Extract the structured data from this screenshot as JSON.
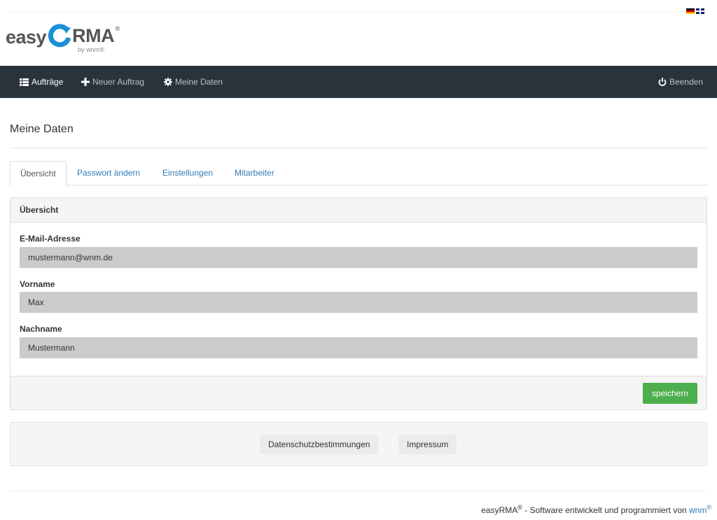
{
  "languages": [
    "Deutsch",
    "English"
  ],
  "logo": {
    "easy": "easy",
    "rma": "RMA",
    "reg": "®",
    "by": "by wnm®"
  },
  "nav": {
    "orders": "Aufträge",
    "new_order": "Neuer Auftrag",
    "my_data": "Meine Daten",
    "logout": "Beenden"
  },
  "page": {
    "title": "Meine Daten"
  },
  "tabs": [
    {
      "label": "Übersicht",
      "active": true
    },
    {
      "label": "Passwort ändern",
      "active": false
    },
    {
      "label": "Einstellungen",
      "active": false
    },
    {
      "label": "Mitarbeiter",
      "active": false
    }
  ],
  "panel": {
    "heading": "Übersicht",
    "fields": [
      {
        "label": "E-Mail-Adresse",
        "value": "mustermann@wnm.de"
      },
      {
        "label": "Vorname",
        "value": "Max"
      },
      {
        "label": "Nachname",
        "value": "Mustermann"
      }
    ],
    "save_label": "speichern"
  },
  "footer_links": {
    "privacy": "Datenschutzbestimmungen",
    "imprint": "Impressum"
  },
  "copyright": {
    "product": "easyRMA",
    "reg": "®",
    "text": " - Software entwickelt und programmiert von ",
    "vendor": "wnm",
    "vendor_reg": "®"
  },
  "colors": {
    "navbar": "#2a333c",
    "accent": "#337ab7",
    "success": "#4cae4c",
    "logo_ring": "#1b8fd6"
  }
}
